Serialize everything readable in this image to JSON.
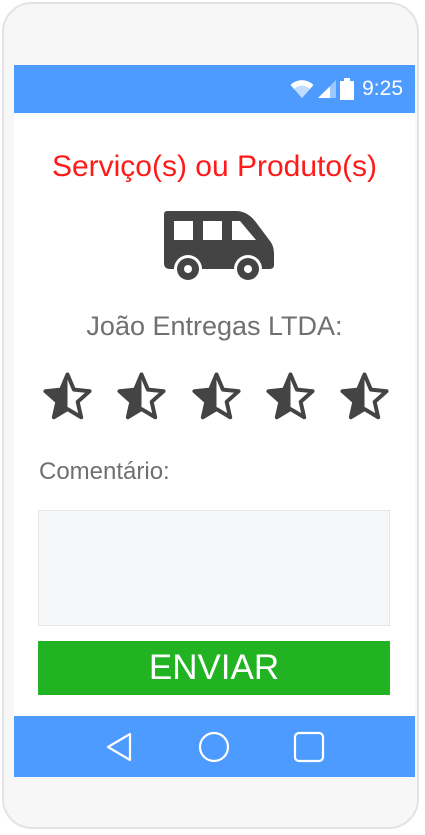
{
  "status_bar": {
    "time": "9:25",
    "icons": [
      "wifi-icon",
      "signal-icon",
      "battery-icon"
    ],
    "color": "#4d9bff"
  },
  "form": {
    "title": "Serviço(s) ou Produto(s)",
    "title_color": "#ff1a1a",
    "vehicle_icon": "van-icon",
    "company": "João Entregas LTDA:",
    "rating": {
      "max": 5,
      "stars": [
        "half-star-icon",
        "half-star-icon",
        "half-star-icon",
        "half-star-icon",
        "half-star-icon"
      ]
    },
    "comment_label": "Comentário:",
    "comment_value": "",
    "submit_label": "ENVIAR",
    "submit_color": "#22b322"
  },
  "nav_bar": {
    "buttons": [
      "back-icon",
      "home-icon",
      "recents-icon"
    ],
    "color": "#4d9bff"
  }
}
